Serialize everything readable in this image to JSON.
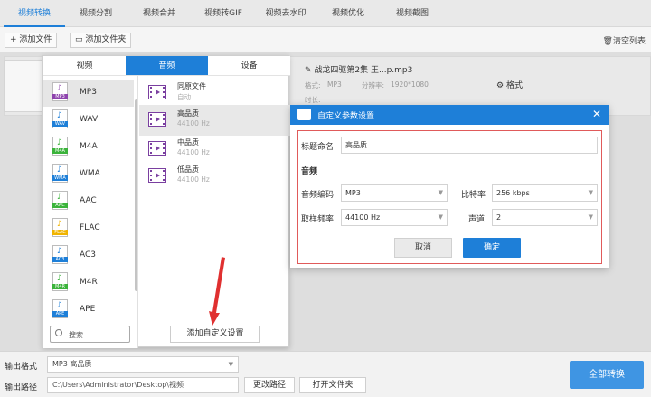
{
  "nav": {
    "tabs": [
      "视频转换",
      "视频分割",
      "视频合并",
      "视频转GIF",
      "视频去水印",
      "视频优化",
      "视频截图"
    ],
    "active_index": 0
  },
  "toolbar": {
    "add_file": "添加文件",
    "add_folder": "添加文件夹",
    "clear_list": "清空列表"
  },
  "file": {
    "name": "战龙四驱第2集 王...p.mp3",
    "format_label": "格式:",
    "format_value": "MP3",
    "resolution_label": "分辨率:",
    "resolution_value": "1920*1080",
    "duration_label": "时长:",
    "format_button": "格式"
  },
  "format_panel": {
    "tabs": [
      "视频",
      "音频",
      "设备"
    ],
    "active_tab": "音频",
    "formats": [
      {
        "label": "MP3",
        "color": "#8e44ad"
      },
      {
        "label": "WAV",
        "color": "#1e7fd8"
      },
      {
        "label": "M4A",
        "color": "#3bb33b"
      },
      {
        "label": "WMA",
        "color": "#1e7fd8"
      },
      {
        "label": "AAC",
        "color": "#3bb33b"
      },
      {
        "label": "FLAC",
        "color": "#f0b400"
      },
      {
        "label": "AC3",
        "color": "#1e7fd8"
      },
      {
        "label": "M4R",
        "color": "#3bb33b"
      },
      {
        "label": "APE",
        "color": "#1e7fd8"
      }
    ],
    "selected_format": "MP3",
    "qualities": [
      {
        "name": "同原文件",
        "sub": "自动"
      },
      {
        "name": "高品质",
        "sub": "44100 Hz"
      },
      {
        "name": "中品质",
        "sub": "44100 Hz"
      },
      {
        "name": "低品质",
        "sub": "44100 Hz"
      }
    ],
    "selected_quality": "高品质",
    "search_placeholder": "搜索",
    "add_custom": "添加自定义设置"
  },
  "dialog": {
    "title": "自定义参数设置",
    "name_label": "标题命名",
    "name_value": "高品质",
    "section_audio": "音频",
    "codec_label": "音频编码",
    "codec_value": "MP3",
    "bitrate_label": "比特率",
    "bitrate_value": "256 kbps",
    "samplerate_label": "取样频率",
    "samplerate_value": "44100 Hz",
    "channel_label": "声道",
    "channel_value": "2",
    "cancel": "取消",
    "ok": "确定"
  },
  "bottom": {
    "output_format_label": "输出格式",
    "output_format_value": "MP3  高品质",
    "output_path_label": "输出路径",
    "output_path_value": "C:\\Users\\Administrator\\Desktop\\视频",
    "change_path": "更改路径",
    "open_folder": "打开文件夹",
    "convert_all": "全部转换"
  },
  "colors": {
    "accent": "#1e7fd8",
    "highlight_border": "#e05a5a",
    "arrow": "#e03030"
  }
}
